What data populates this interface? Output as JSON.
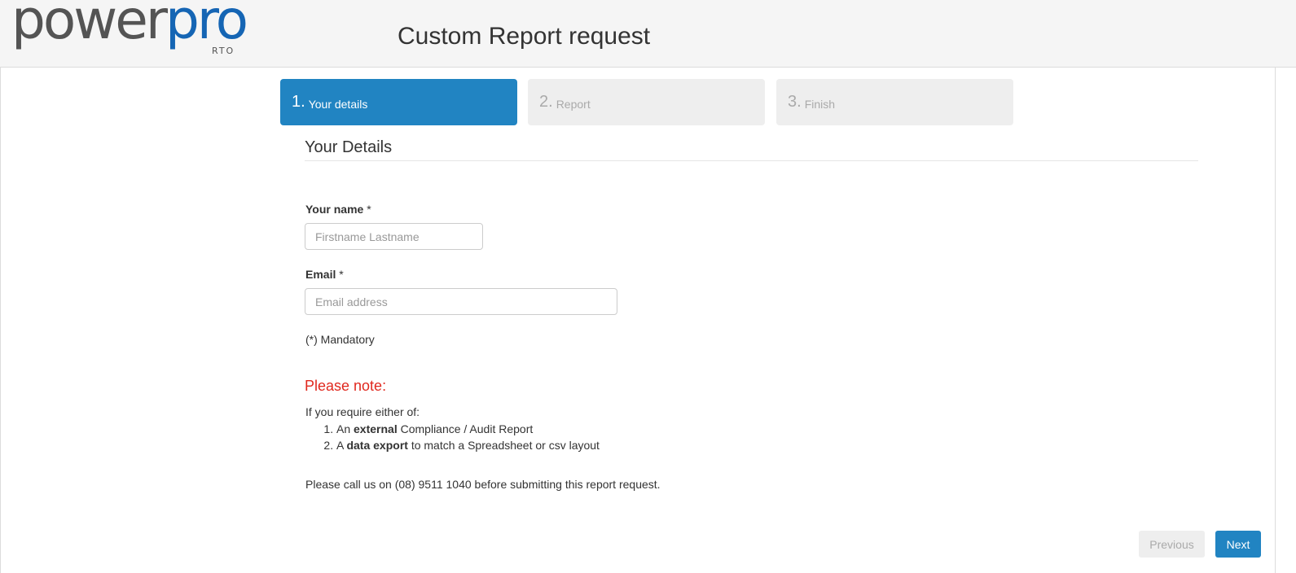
{
  "header": {
    "logo": {
      "part1": "power",
      "part2": "pro",
      "sub": "RTO"
    },
    "title": "Custom Report request"
  },
  "steps": [
    {
      "num": "1.",
      "label": "Your details",
      "active": true
    },
    {
      "num": "2.",
      "label": "Report",
      "active": false
    },
    {
      "num": "3.",
      "label": "Finish",
      "active": false
    }
  ],
  "form": {
    "section_title": "Your Details",
    "name": {
      "label": "Your name",
      "required_mark": "*",
      "placeholder": "Firstname Lastname",
      "value": ""
    },
    "email": {
      "label": "Email",
      "required_mark": "*",
      "placeholder": "Email address",
      "value": ""
    },
    "mandatory_note": "(*) Mandatory"
  },
  "note": {
    "title": "Please note:",
    "intro": "If you require either of:",
    "items": [
      {
        "prefix": "An ",
        "bold": "external",
        "suffix": " Compliance / Audit Report"
      },
      {
        "prefix": "A ",
        "bold": "data export",
        "suffix": " to match a Spreadsheet or csv layout"
      }
    ],
    "call_text": "Please call us on (08) 9511 1040 before submitting this report request."
  },
  "buttons": {
    "previous": "Previous",
    "next": "Next"
  },
  "colors": {
    "brand_blue": "#2184c2",
    "logo_blue": "#1565b4",
    "logo_grey": "#545454",
    "note_red": "#e0281e"
  }
}
